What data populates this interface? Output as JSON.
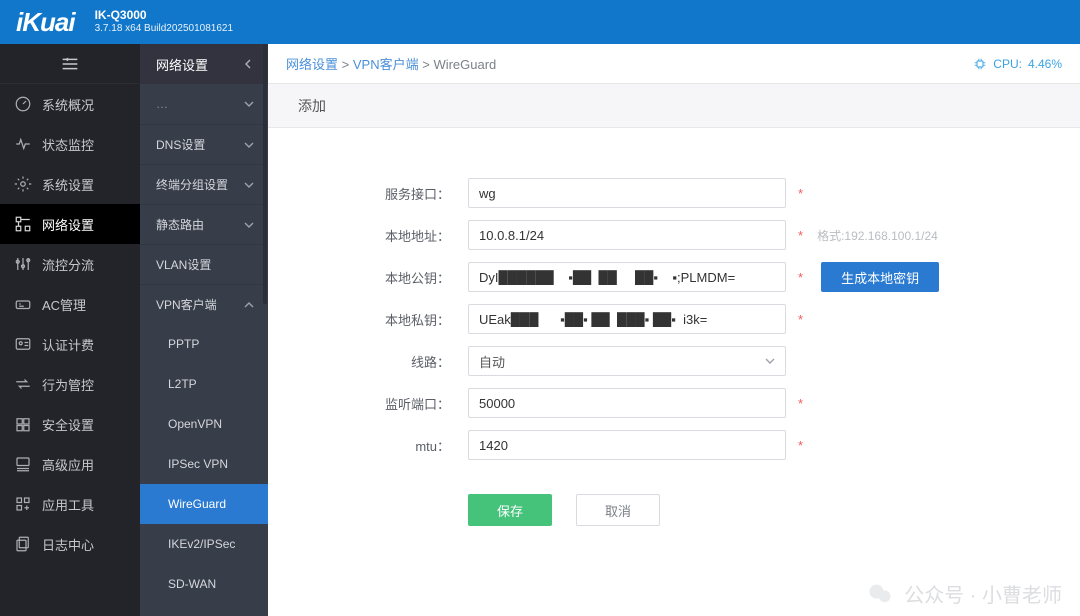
{
  "header": {
    "logo": "iKuai",
    "model": "IK-Q3000",
    "build": "3.7.18 x64 Build202501081621"
  },
  "nav1": {
    "items": [
      {
        "icon": "gauge-icon",
        "label": "系统概况"
      },
      {
        "icon": "activity-icon",
        "label": "状态监控"
      },
      {
        "icon": "gear-icon",
        "label": "系统设置"
      },
      {
        "icon": "network-icon",
        "label": "网络设置",
        "active": true
      },
      {
        "icon": "sliders-icon",
        "label": "流控分流"
      },
      {
        "icon": "wifi-icon",
        "label": "AC管理"
      },
      {
        "icon": "id-icon",
        "label": "认证计费"
      },
      {
        "icon": "swap-icon",
        "label": "行为管控"
      },
      {
        "icon": "shield-icon",
        "label": "安全设置"
      },
      {
        "icon": "app-icon",
        "label": "高级应用"
      },
      {
        "icon": "grid-icon",
        "label": "应用工具"
      },
      {
        "icon": "copy-icon",
        "label": "日志中心"
      }
    ]
  },
  "nav2": {
    "title": "网络设置",
    "sections": [
      {
        "label": "DNS设置",
        "type": "sec"
      },
      {
        "label": "终端分组设置",
        "type": "sec"
      },
      {
        "label": "静态路由",
        "type": "sec"
      },
      {
        "label": "VLAN设置",
        "type": "plain"
      },
      {
        "label": "VPN客户端",
        "type": "sec",
        "open": true
      },
      {
        "label": "PPTP",
        "type": "sub"
      },
      {
        "label": "L2TP",
        "type": "sub"
      },
      {
        "label": "OpenVPN",
        "type": "sub"
      },
      {
        "label": "IPSec VPN",
        "type": "sub"
      },
      {
        "label": "WireGuard",
        "type": "sub",
        "active": true
      },
      {
        "label": "IKEv2/IPSec",
        "type": "sub"
      },
      {
        "label": "SD-WAN",
        "type": "sub"
      }
    ]
  },
  "crumbs": {
    "a": "网络设置",
    "b": "VPN客户端",
    "c": "WireGuard",
    "cpu_label": "CPU:",
    "cpu_value": "4.46%"
  },
  "subhead": "添加",
  "form": {
    "service_if": {
      "label": "服务接口：",
      "value": "wg"
    },
    "local_addr": {
      "label": "本地地址：",
      "value": "10.0.8.1/24",
      "hint": "格式:192.168.100.1/24"
    },
    "local_pub": {
      "label": "本地公钥：",
      "value": "DyI██████    ▪██  ██     ██▪    ▪;PLMDM="
    },
    "local_priv": {
      "label": "本地私钥：",
      "value": "UEak███      ▪██▪ ██  ███▪ ██▪  i3k="
    },
    "gen_key_btn": "生成本地密钥",
    "line": {
      "label": "线路：",
      "value": "自动"
    },
    "listen_port": {
      "label": "监听端口：",
      "value": "50000"
    },
    "mtu": {
      "label": "mtu：",
      "value": "1420"
    },
    "save": "保存",
    "cancel": "取消",
    "req": "*"
  },
  "watermark": "公众号 · 小曹老师"
}
